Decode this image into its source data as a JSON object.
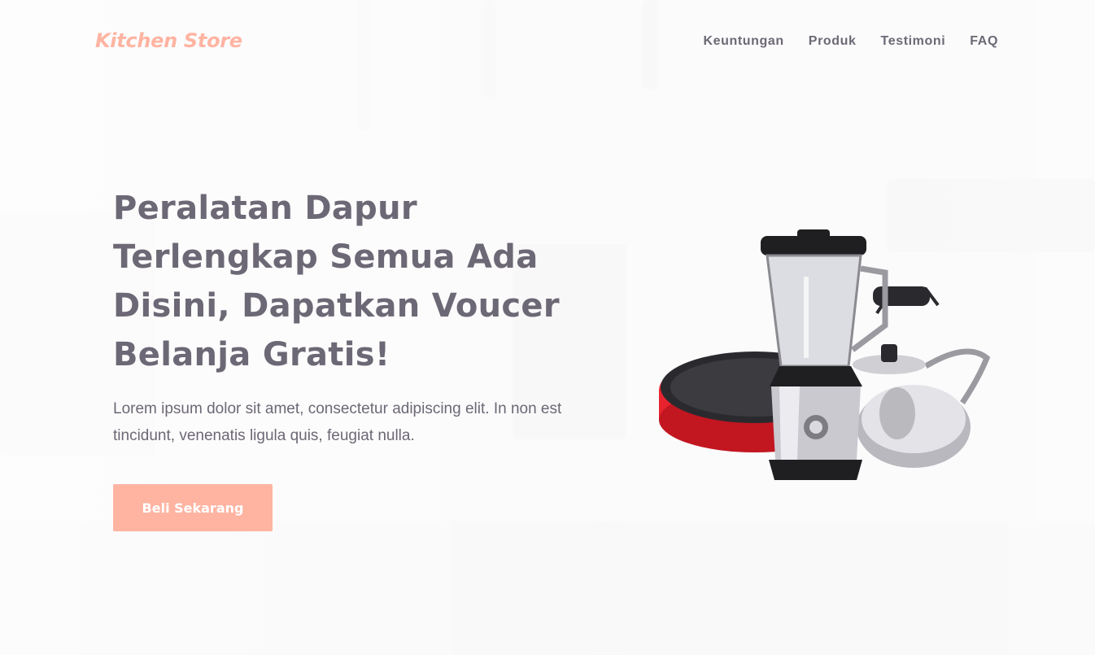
{
  "brand": {
    "name": "Kitchen Store"
  },
  "nav": {
    "items": [
      "Keuntungan",
      "Produk",
      "Testimoni",
      "FAQ"
    ]
  },
  "hero": {
    "title": "Peralatan Dapur Terlengkap Semua Ada Disini, Dapatkan Voucer Belanja Gratis!",
    "description": "Lorem ipsum dolor sit amet, consectetur adipiscing elit. In non est tincidunt, venenatis ligula quis, feugiat nulla.",
    "cta_label": "Beli Sekarang"
  },
  "colors": {
    "accent": "#ffb4a2",
    "text": "#6d6875",
    "pan_red": "#e8232e"
  },
  "icons": {
    "hero_image": "kitchen-appliances-image"
  }
}
